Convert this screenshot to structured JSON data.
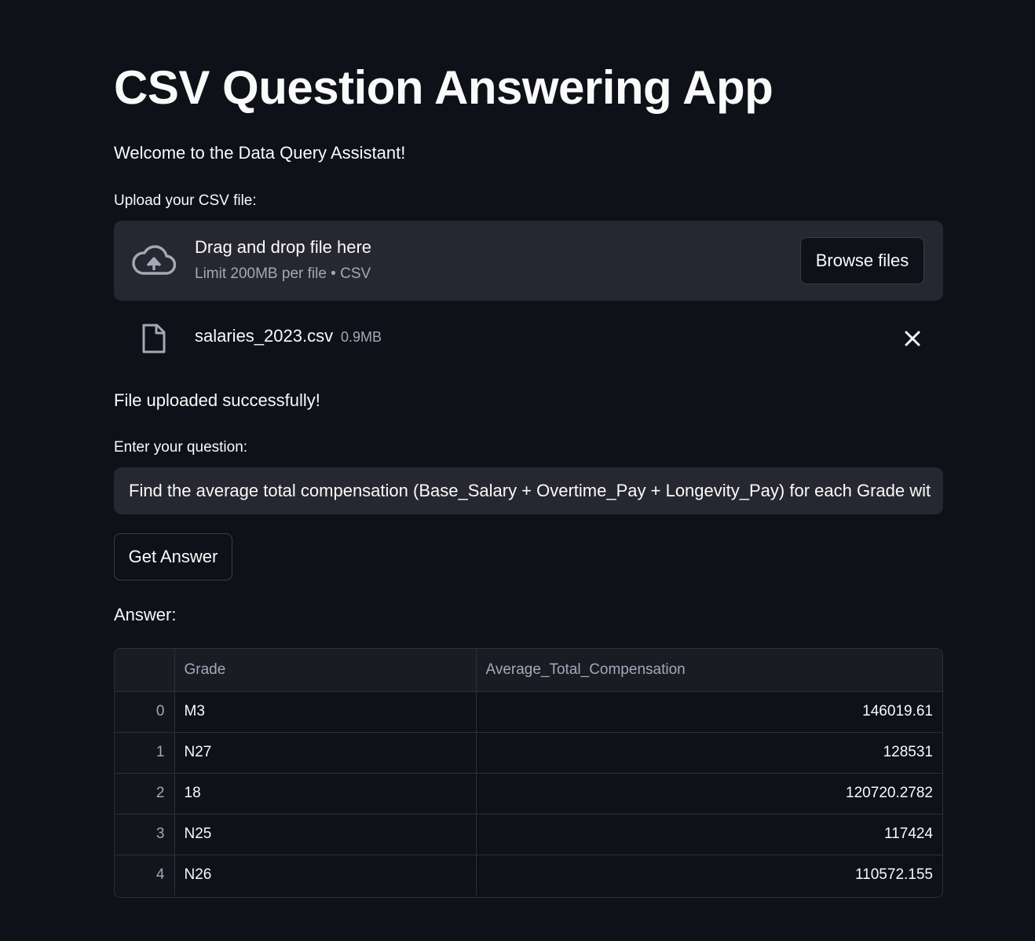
{
  "header": {
    "title": "CSV Question Answering App",
    "welcome": "Welcome to the Data Query Assistant!"
  },
  "uploader": {
    "label": "Upload your CSV file:",
    "drop_text": "Drag and drop file here",
    "limit_text": "Limit 200MB per file • CSV",
    "browse_label": "Browse files",
    "icon": "cloud-upload-icon"
  },
  "uploaded_file": {
    "name": "salaries_2023.csv",
    "size": "0.9MB",
    "icon": "file-icon",
    "remove_icon": "close-icon"
  },
  "status": {
    "message": "File uploaded successfully!"
  },
  "question": {
    "label": "Enter your question:",
    "value": "Find the average total compensation (Base_Salary + Overtime_Pay + Longevity_Pay) for each Grade wit"
  },
  "actions": {
    "get_answer_label": "Get Answer"
  },
  "answer": {
    "label": "Answer:",
    "columns": [
      "",
      "Grade",
      "Average_Total_Compensation"
    ],
    "rows": [
      {
        "index": "0",
        "grade": "M3",
        "value": "146019.61"
      },
      {
        "index": "1",
        "grade": "N27",
        "value": "128531"
      },
      {
        "index": "2",
        "grade": "18",
        "value": "120720.2782"
      },
      {
        "index": "3",
        "grade": "N25",
        "value": "117424"
      },
      {
        "index": "4",
        "grade": "N26",
        "value": "110572.155"
      }
    ]
  },
  "colors": {
    "background": "#0e1117",
    "surface": "#262730",
    "text": "#fafafa",
    "muted_text": "#a3a8b8",
    "border": "#2d3039"
  }
}
